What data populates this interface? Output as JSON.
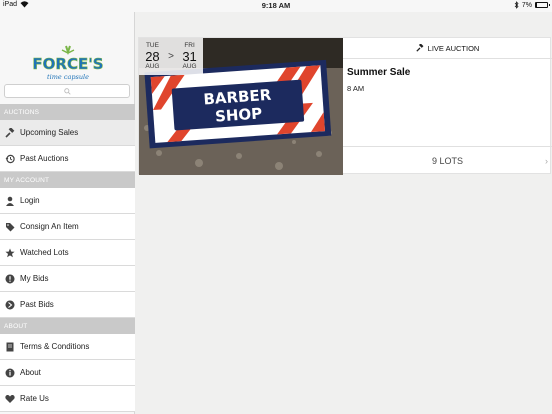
{
  "status_bar": {
    "carrier": "iPad",
    "time": "9:18 AM",
    "battery": "7%"
  },
  "sidebar": {
    "logo_text": "FORCE'S",
    "logo_subtext": "time capsule",
    "sections": [
      {
        "header": "AUCTIONS",
        "items": [
          {
            "label": "Upcoming Sales",
            "icon": "gavel-icon",
            "active": true
          },
          {
            "label": "Past Auctions",
            "icon": "history-icon",
            "active": false
          }
        ]
      },
      {
        "header": "MY ACCOUNT",
        "items": [
          {
            "label": "Login",
            "icon": "person-icon"
          },
          {
            "label": "Consign An Item",
            "icon": "tag-icon"
          },
          {
            "label": "Watched Lots",
            "icon": "star-icon"
          },
          {
            "label": "My Bids",
            "icon": "bid-icon"
          },
          {
            "label": "Past Bids",
            "icon": "past-bid-icon"
          }
        ]
      },
      {
        "header": "ABOUT",
        "items": [
          {
            "label": "Terms & Conditions",
            "icon": "book-icon"
          },
          {
            "label": "About",
            "icon": "info-icon"
          },
          {
            "label": "Rate Us",
            "icon": "heart-icon"
          }
        ]
      }
    ]
  },
  "auction_card": {
    "start": {
      "dow": "TUE",
      "day": "28",
      "month": "AUG"
    },
    "separator": ">",
    "end": {
      "dow": "FRI",
      "day": "31",
      "month": "AUG"
    },
    "badge": "LIVE AUCTION",
    "title": "Summer Sale",
    "time": "8 AM",
    "lots": "9 LOTS",
    "image_sign_line1": "BARBER",
    "image_sign_line2": "SHOP"
  },
  "colors": {
    "section_header": "#c9c9c9",
    "logo_blue": "#1e73b8",
    "logo_green": "#7ab648"
  }
}
